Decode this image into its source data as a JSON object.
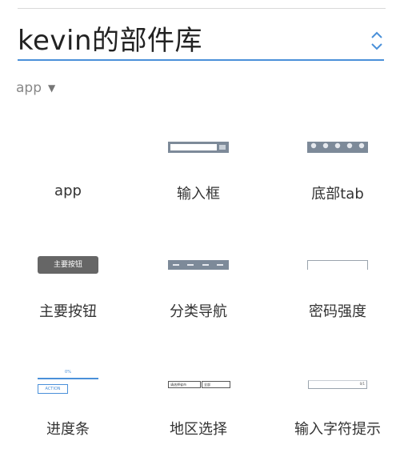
{
  "header": {
    "title": "kevin的部件库"
  },
  "section": {
    "label": "app"
  },
  "widgets": [
    {
      "label": "app",
      "icon": "blank-thumbnail"
    },
    {
      "label": "输入框",
      "icon": "input-box-thumbnail"
    },
    {
      "label": "底部tab",
      "icon": "bottom-tab-thumbnail"
    },
    {
      "label": "主要按钮",
      "icon": "primary-button-thumbnail",
      "thumb_text": "主要按钮"
    },
    {
      "label": "分类导航",
      "icon": "category-nav-thumbnail"
    },
    {
      "label": "密码强度",
      "icon": "password-strength-thumbnail"
    },
    {
      "label": "进度条",
      "icon": "progress-bar-thumbnail",
      "thumb_percent": "0%",
      "thumb_button": "ACTION"
    },
    {
      "label": "地区选择",
      "icon": "region-select-thumbnail",
      "thumb_select1": "请选择省市",
      "thumb_select2": "全部"
    },
    {
      "label": "输入字符提示",
      "icon": "char-hint-thumbnail",
      "thumb_count": "0/1"
    }
  ],
  "colors": {
    "accent": "#4a90d9",
    "thumb_gray": "#7d8a99",
    "button_dark": "#666666"
  }
}
